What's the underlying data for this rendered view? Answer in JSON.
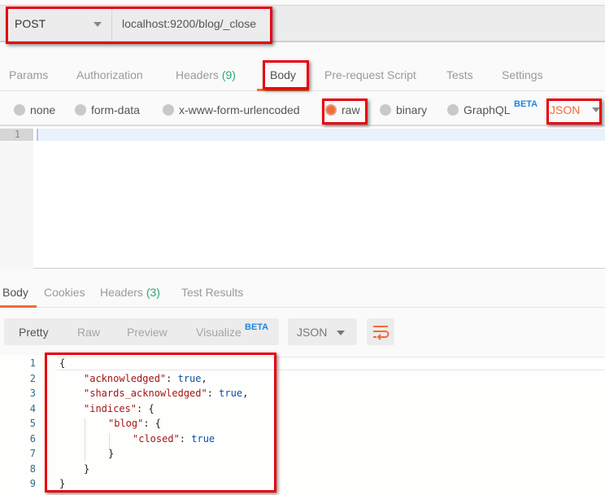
{
  "request": {
    "method": "POST",
    "url": "localhost:9200/blog/_close",
    "tabs": [
      {
        "label": "Params",
        "count": null,
        "active": false
      },
      {
        "label": "Authorization",
        "count": null,
        "active": false
      },
      {
        "label": "Headers",
        "count": "(9)",
        "active": false
      },
      {
        "label": "Body",
        "count": null,
        "active": true
      },
      {
        "label": "Pre-request Script",
        "count": null,
        "active": false
      },
      {
        "label": "Tests",
        "count": null,
        "active": false
      },
      {
        "label": "Settings",
        "count": null,
        "active": false
      }
    ],
    "body_types": [
      {
        "label": "none",
        "selected": false
      },
      {
        "label": "form-data",
        "selected": false
      },
      {
        "label": "x-www-form-urlencoded",
        "selected": false
      },
      {
        "label": "raw",
        "selected": true
      },
      {
        "label": "binary",
        "selected": false
      },
      {
        "label": "GraphQL",
        "selected": false,
        "badge": "BETA"
      }
    ],
    "language": "JSON",
    "editor": {
      "line_numbers": [
        "1"
      ],
      "content": ""
    }
  },
  "response": {
    "tabs": [
      {
        "label": "Body",
        "count": null,
        "active": true
      },
      {
        "label": "Cookies",
        "count": null,
        "active": false
      },
      {
        "label": "Headers",
        "count": "(3)",
        "active": false
      },
      {
        "label": "Test Results",
        "count": null,
        "active": false
      }
    ],
    "views": [
      {
        "label": "Pretty",
        "active": true
      },
      {
        "label": "Raw",
        "active": false
      },
      {
        "label": "Preview",
        "active": false
      },
      {
        "label": "Visualize",
        "active": false,
        "badge": "BETA"
      }
    ],
    "format": "JSON",
    "wrap_icon": "wrap-lines-icon",
    "code_lines": [
      {
        "n": "1",
        "indent": 0,
        "key": null,
        "text": "{"
      },
      {
        "n": "2",
        "indent": 1,
        "key": "\"acknowledged\"",
        "text": ": ",
        "value": "true",
        "tail": ","
      },
      {
        "n": "3",
        "indent": 1,
        "key": "\"shards_acknowledged\"",
        "text": ": ",
        "value": "true",
        "tail": ","
      },
      {
        "n": "4",
        "indent": 1,
        "key": "\"indices\"",
        "text": ": {"
      },
      {
        "n": "5",
        "indent": 2,
        "key": "\"blog\"",
        "text": ": {"
      },
      {
        "n": "6",
        "indent": 3,
        "key": "\"closed\"",
        "text": ": ",
        "value": "true"
      },
      {
        "n": "7",
        "indent": 2,
        "key": null,
        "text": "}"
      },
      {
        "n": "8",
        "indent": 1,
        "key": null,
        "text": "}"
      },
      {
        "n": "9",
        "indent": 0,
        "key": null,
        "text": "}"
      }
    ]
  },
  "colors": {
    "accent": "#f26b3a",
    "count": "#2aa772",
    "beta": "#1b87e6",
    "highlight_box": "#e8000b"
  }
}
